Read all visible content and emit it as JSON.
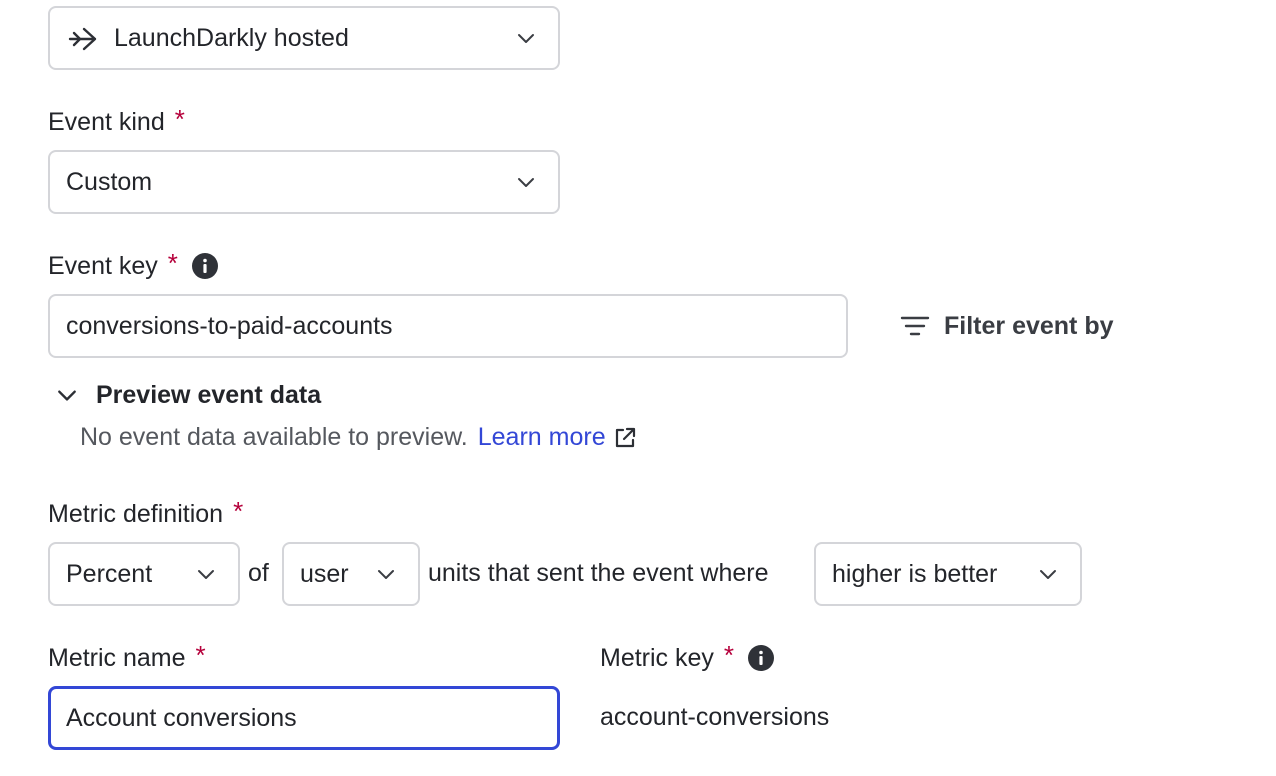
{
  "data_source": {
    "value": "LaunchDarkly hosted",
    "icon": "arrow-right-icon"
  },
  "event_kind": {
    "label": "Event kind",
    "required_mark": "*",
    "value": "Custom"
  },
  "event_key": {
    "label": "Event key",
    "required_mark": "*",
    "value": "conversions-to-paid-accounts",
    "filter_label": "Filter event by"
  },
  "preview": {
    "heading": "Preview event data",
    "message": "No event data available to preview.",
    "learn_more": "Learn more"
  },
  "metric_definition": {
    "label": "Metric definition",
    "required_mark": "*",
    "measure": "Percent",
    "of_text": "of",
    "unit": "user",
    "units_text": "units that sent the event where",
    "direction": "higher is better"
  },
  "metric_name": {
    "label": "Metric name",
    "required_mark": "*",
    "value": "Account conversions"
  },
  "metric_key": {
    "label": "Metric key",
    "required_mark": "*",
    "value": "account-conversions"
  },
  "colors": {
    "required": "#b5003b",
    "link": "#3347d6",
    "focus": "#3347d6",
    "border": "#d4d5d9"
  }
}
